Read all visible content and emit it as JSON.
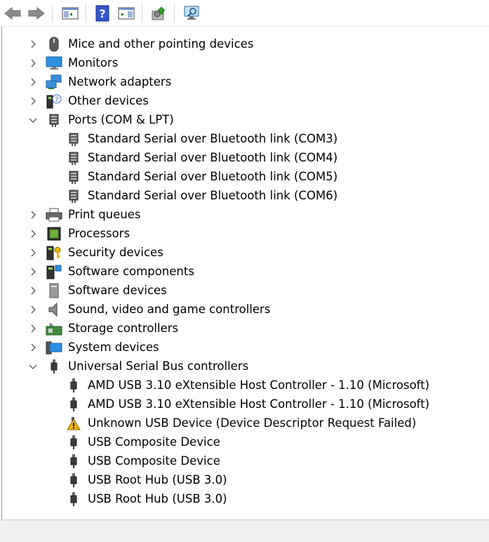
{
  "toolbar": {
    "buttons": [
      "back-icon",
      "forward-icon",
      "show-hide-console-tree-icon",
      "help-icon",
      "action-pane-icon",
      "update-driver-icon",
      "scan-hardware-icon"
    ]
  },
  "tree": {
    "items": [
      {
        "label": "Mice and other pointing devices",
        "icon": "mouse-icon",
        "expanded": false
      },
      {
        "label": "Monitors",
        "icon": "monitor-icon",
        "expanded": false
      },
      {
        "label": "Network adapters",
        "icon": "network-adapter-icon",
        "expanded": false
      },
      {
        "label": "Other devices",
        "icon": "other-devices-icon",
        "expanded": false
      },
      {
        "label": "Ports (COM & LPT)",
        "icon": "port-icon",
        "expanded": true
      },
      {
        "label": "Standard Serial over Bluetooth link (COM3)",
        "icon": "port-icon",
        "child": true
      },
      {
        "label": "Standard Serial over Bluetooth link (COM4)",
        "icon": "port-icon",
        "child": true
      },
      {
        "label": "Standard Serial over Bluetooth link (COM5)",
        "icon": "port-icon",
        "child": true
      },
      {
        "label": "Standard Serial over Bluetooth link (COM6)",
        "icon": "port-icon",
        "child": true
      },
      {
        "label": "Print queues",
        "icon": "printer-icon",
        "expanded": false
      },
      {
        "label": "Processors",
        "icon": "processor-icon",
        "expanded": false
      },
      {
        "label": "Security devices",
        "icon": "security-key-icon",
        "expanded": false
      },
      {
        "label": "Software components",
        "icon": "software-component-icon",
        "expanded": false
      },
      {
        "label": "Software devices",
        "icon": "software-device-icon",
        "expanded": false
      },
      {
        "label": "Sound, video and game controllers",
        "icon": "speaker-icon",
        "expanded": false
      },
      {
        "label": "Storage controllers",
        "icon": "storage-controller-icon",
        "expanded": false
      },
      {
        "label": "System devices",
        "icon": "system-device-icon",
        "expanded": false
      },
      {
        "label": "Universal Serial Bus controllers",
        "icon": "usb-icon",
        "expanded": true
      },
      {
        "label": "AMD USB 3.10 eXtensible Host Controller - 1.10 (Microsoft)",
        "icon": "usb-icon",
        "child": true
      },
      {
        "label": "AMD USB 3.10 eXtensible Host Controller - 1.10 (Microsoft)",
        "icon": "usb-icon",
        "child": true
      },
      {
        "label": "Unknown USB Device (Device Descriptor Request Failed)",
        "icon": "warning-icon",
        "child": true
      },
      {
        "label": "USB Composite Device",
        "icon": "usb-icon",
        "child": true
      },
      {
        "label": "USB Composite Device",
        "icon": "usb-icon",
        "child": true
      },
      {
        "label": "USB Root Hub (USB 3.0)",
        "icon": "usb-icon",
        "child": true
      },
      {
        "label": "USB Root Hub (USB 3.0)",
        "icon": "usb-icon",
        "child": true
      }
    ]
  },
  "colors": {
    "accent": "#1e6fd9",
    "warning": "#f2b600",
    "gray": "#555555"
  }
}
